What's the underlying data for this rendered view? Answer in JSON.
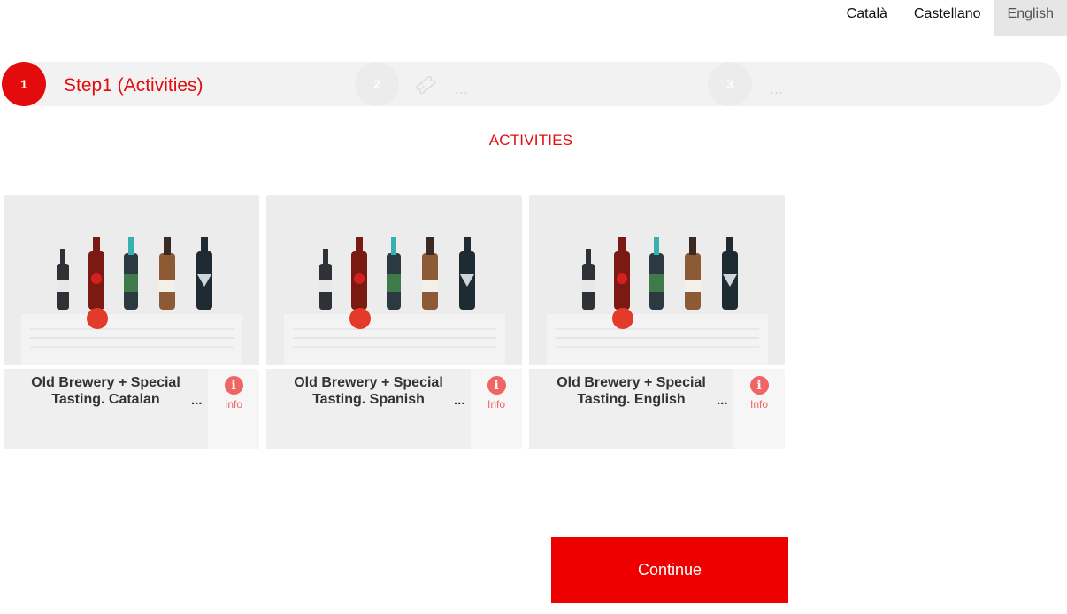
{
  "languages": [
    "Català",
    "Castellano",
    "English"
  ],
  "active_language": "English",
  "steps": {
    "step1_number": "1",
    "step1_label": "Step1 (Activities)",
    "step2_number": "2",
    "step2_ellipsis": "...",
    "step3_number": "3",
    "step3_ellipsis": "..."
  },
  "section_title": "ACTIVITIES",
  "cards": [
    {
      "title": "Old Brewery + Special Tasting. Catalan",
      "ellipsis": "...",
      "info_label": "Info"
    },
    {
      "title": "Old Brewery + Special Tasting. Spanish",
      "ellipsis": "...",
      "info_label": "Info"
    },
    {
      "title": "Old Brewery + Special Tasting. English",
      "ellipsis": "...",
      "info_label": "Info"
    }
  ],
  "continue_label": "Continue",
  "colors": {
    "accent": "#e30b0b",
    "info": "#f06464",
    "button": "#ee0000"
  }
}
